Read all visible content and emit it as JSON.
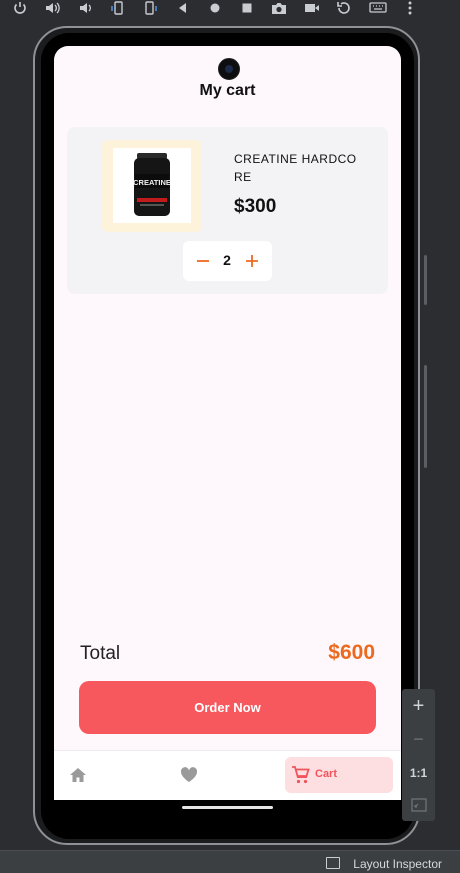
{
  "emulator": {
    "toolbar_icons": [
      "power-icon",
      "volume-up-icon",
      "volume-down-icon",
      "rotate-left-icon",
      "rotate-right-icon",
      "back-icon",
      "home-icon",
      "overview-icon",
      "camera-icon",
      "record-icon",
      "replay-icon",
      "keyboard-icon",
      "more-icon"
    ],
    "zoom_panel": {
      "zoom_in": "+",
      "zoom_out": "−",
      "actual_size": "1:1"
    },
    "status": {
      "layout_inspector": "Layout Inspector"
    }
  },
  "app": {
    "title": "My cart",
    "cart_items": [
      {
        "name": "CREATINE HARDCORE",
        "name_display": "CREATINE HARDCO\nRE",
        "price": "$300",
        "quantity": "2",
        "image_label": "CREATINE"
      }
    ],
    "total": {
      "label": "Total",
      "value": "$600"
    },
    "order_button": "Order Now",
    "nav": {
      "cart_label": "Cart"
    }
  },
  "colors": {
    "accent_orange": "#ec6a1f",
    "button_red": "#f7585e",
    "cart_tab_bg": "#fedfe1"
  }
}
